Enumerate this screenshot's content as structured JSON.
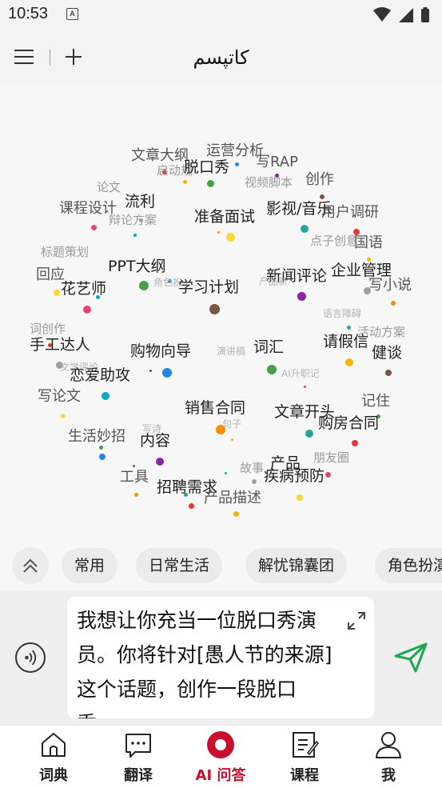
{
  "status_bar": {
    "time": "10:53",
    "notification_letter": "A"
  },
  "app_bar": {
    "title": "کاتپسم"
  },
  "word_cloud": {
    "words": [
      {
        "text": "运营分析",
        "size": "m"
      },
      {
        "text": "文章大纲",
        "size": "m"
      },
      {
        "text": "写RAP",
        "size": "m"
      },
      {
        "text": "启动规",
        "size": "s"
      },
      {
        "text": "脱口秀",
        "size": "l"
      },
      {
        "text": "视频脚本",
        "size": "s"
      },
      {
        "text": "创作",
        "size": "m"
      },
      {
        "text": "论文",
        "size": "s"
      },
      {
        "text": "流利",
        "size": "l"
      },
      {
        "text": "课程设计",
        "size": "m"
      },
      {
        "text": "准备面试",
        "size": "l"
      },
      {
        "text": "影视/音乐",
        "size": "l"
      },
      {
        "text": "用户调研",
        "size": "m"
      },
      {
        "text": "辩论方案",
        "size": "s"
      },
      {
        "text": "点子创意",
        "size": "s"
      },
      {
        "text": "国语",
        "size": "m"
      },
      {
        "text": "标题策划",
        "size": "s"
      },
      {
        "text": "PPT大纲",
        "size": "l"
      },
      {
        "text": "企业管理",
        "size": "l"
      },
      {
        "text": "新闻评论",
        "size": "l"
      },
      {
        "text": "回应",
        "size": "m"
      },
      {
        "text": "角色扮",
        "size": "xs"
      },
      {
        "text": "产品新",
        "size": "xs"
      },
      {
        "text": "写小说",
        "size": "m"
      },
      {
        "text": "花艺师",
        "size": "l"
      },
      {
        "text": "学习计划",
        "size": "l"
      },
      {
        "text": "语言障碍",
        "size": "xs"
      },
      {
        "text": "词创作",
        "size": "s"
      },
      {
        "text": "活动方案",
        "size": "s"
      },
      {
        "text": "手工达人",
        "size": "l"
      },
      {
        "text": "购物向导",
        "size": "l"
      },
      {
        "text": "演讲稿",
        "size": "xs"
      },
      {
        "text": "词汇",
        "size": "l"
      },
      {
        "text": "请假信",
        "size": "l"
      },
      {
        "text": "健谈",
        "size": "l"
      },
      {
        "text": "文学评论",
        "size": "xs"
      },
      {
        "text": "恋爱助攻",
        "size": "l"
      },
      {
        "text": "AI升职记",
        "size": "xs"
      },
      {
        "text": "写论文",
        "size": "m"
      },
      {
        "text": "销售合同",
        "size": "l"
      },
      {
        "text": "文章开头",
        "size": "l"
      },
      {
        "text": "记住",
        "size": "m"
      },
      {
        "text": "购房合同",
        "size": "l"
      },
      {
        "text": "句子",
        "size": "xs"
      },
      {
        "text": "生活妙招",
        "size": "m"
      },
      {
        "text": "写诗",
        "size": "xs"
      },
      {
        "text": "内容",
        "size": "l"
      },
      {
        "text": "朋友圈",
        "size": "s"
      },
      {
        "text": "故事",
        "size": "s"
      },
      {
        "text": "产品",
        "size": "l"
      },
      {
        "text": "工具",
        "size": "m"
      },
      {
        "text": "疾病预防",
        "size": "l"
      },
      {
        "text": "招聘需求",
        "size": "l"
      },
      {
        "text": "产品描述",
        "size": "m"
      }
    ],
    "dot_colors": [
      "#e53935",
      "#ffb300",
      "#43a047",
      "#1e88e5",
      "#8e24aa",
      "#795548",
      "#9e9e9e",
      "#00acc1",
      "#ec407a",
      "#fdd835",
      "#fb8c00",
      "#26a69a"
    ]
  },
  "categories": {
    "collapse_icon": "double-chevron-up-icon",
    "chips": [
      "常用",
      "日常生活",
      "解忧锦囊团",
      "角色扮演"
    ]
  },
  "input": {
    "text": "我想让你充当一位脱口秀演员。你将针对[愚人节的来源]这个话题，创作一段脱口秀。"
  },
  "bottom_nav": {
    "items": [
      {
        "label": "词典",
        "icon": "house-icon"
      },
      {
        "label": "翻译",
        "icon": "chat-bubble-icon"
      },
      {
        "label": "AI 问答",
        "icon": "ai-record-icon"
      },
      {
        "label": "课程",
        "icon": "notebook-icon"
      },
      {
        "label": "我",
        "icon": "person-icon"
      }
    ],
    "active_color": "#c8102e"
  }
}
